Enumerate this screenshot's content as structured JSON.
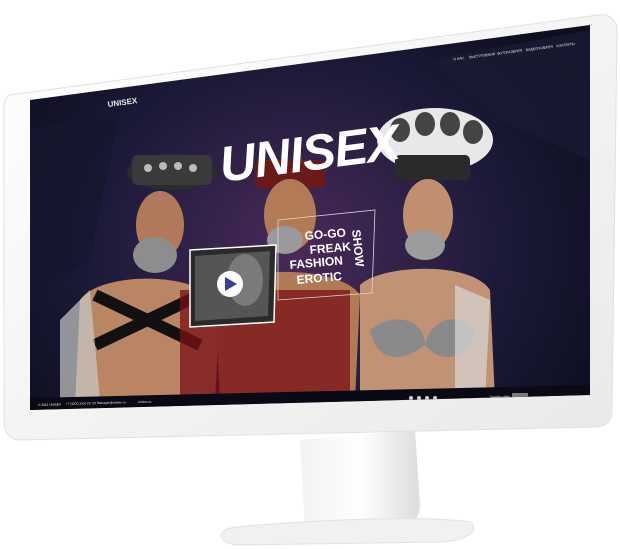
{
  "site": {
    "logo": "UNISEX",
    "headline": "UNISEX",
    "nav": [
      "О НАС",
      "ВЫСТУПЛЕНИЯ",
      "ФОТОГАЛЕРЕЯ",
      "ВИДЕОГАЛЕРЕЯ",
      "КОНТАКТЫ"
    ],
    "show_lines": [
      "GO-GO",
      "FREAK",
      "FASHION",
      "EROTIC"
    ],
    "show_vertical": "SHOW",
    "footer": {
      "copyright": "© 2014 UNISEX",
      "phone": "+7 (9XX) XXX XX XX",
      "email": "Manager@unisex.ru",
      "skype": "Unisex.ru",
      "credit": "Дизайн сайта",
      "social": [
        "facebook-icon",
        "vk-icon",
        "instagram-icon",
        "youtube-icon"
      ]
    }
  },
  "colors": {
    "frame": "#f4f4f4",
    "screen_bg": "#141428",
    "accent": "#3c3ca0"
  }
}
